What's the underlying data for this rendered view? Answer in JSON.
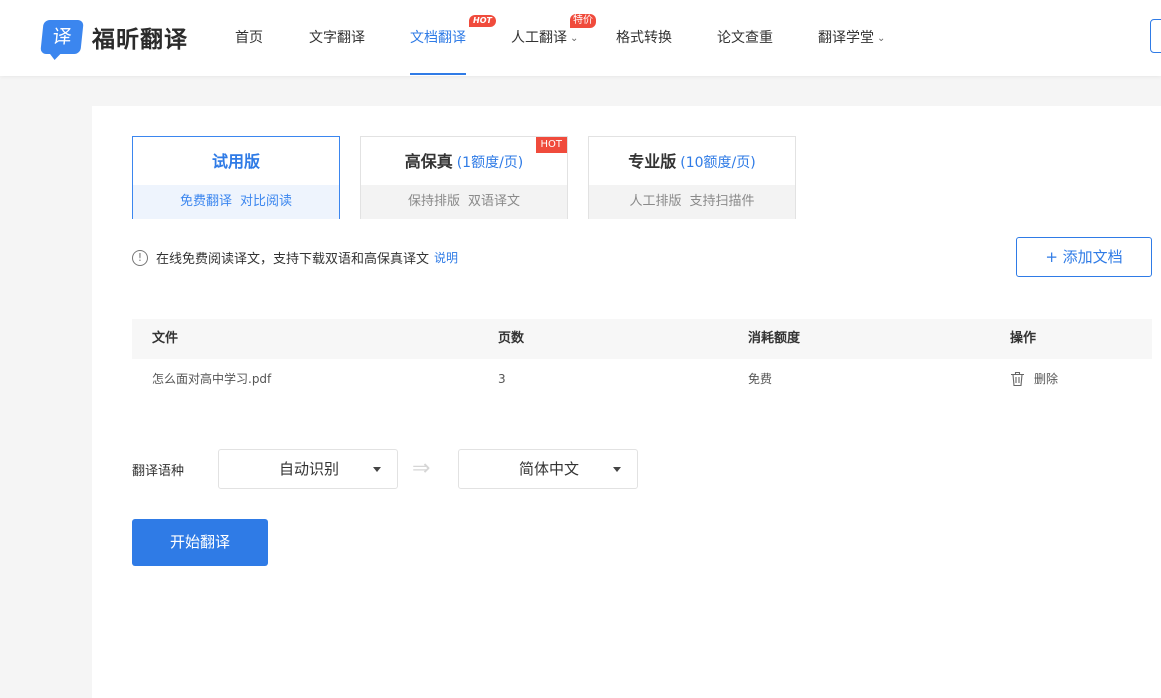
{
  "header": {
    "logo_glyph": "译",
    "logo_text": "福昕翻译",
    "nav": {
      "home": "首页",
      "text_translate": "文字翻译",
      "doc_translate": "文档翻译",
      "human_translate": "人工翻译",
      "format_convert": "格式转换",
      "plagiarism_check": "论文查重",
      "academy": "翻译学堂"
    },
    "badges": {
      "doc_hot": "HOT",
      "human_sale": "特价"
    },
    "active_tab": "doc_translate"
  },
  "versions": {
    "trial": {
      "title": "试用版",
      "tags": [
        "免费翻译",
        "对比阅读"
      ],
      "selected": true
    },
    "hifi": {
      "title": "高保真",
      "quota": "(1额度/页)",
      "tags": [
        "保持排版",
        "双语译文"
      ],
      "badge": "HOT"
    },
    "pro": {
      "title": "专业版",
      "quota": "(10额度/页)",
      "tags": [
        "人工排版",
        "支持扫描件"
      ]
    }
  },
  "notice": {
    "icon": "info-icon",
    "text": "在线免费阅读译文，支持下载双语和高保真译文",
    "link": "说明"
  },
  "add_document_label": "+ 添加文档",
  "file_table": {
    "columns": [
      "文件",
      "页数",
      "消耗额度",
      "操作"
    ],
    "rows": [
      {
        "file": "怎么面对高中学习.pdf",
        "pages": "3",
        "cost": "免费",
        "action": "删除"
      }
    ]
  },
  "language": {
    "label": "翻译语种",
    "source": "自动识别",
    "target": "简体中文",
    "swap_symbol": "⇒"
  },
  "start_label": "开始翻译",
  "colors": {
    "accent": "#2f7be6",
    "hot_badge": "#f04b3c",
    "page_bg": "#f5f5f5"
  }
}
